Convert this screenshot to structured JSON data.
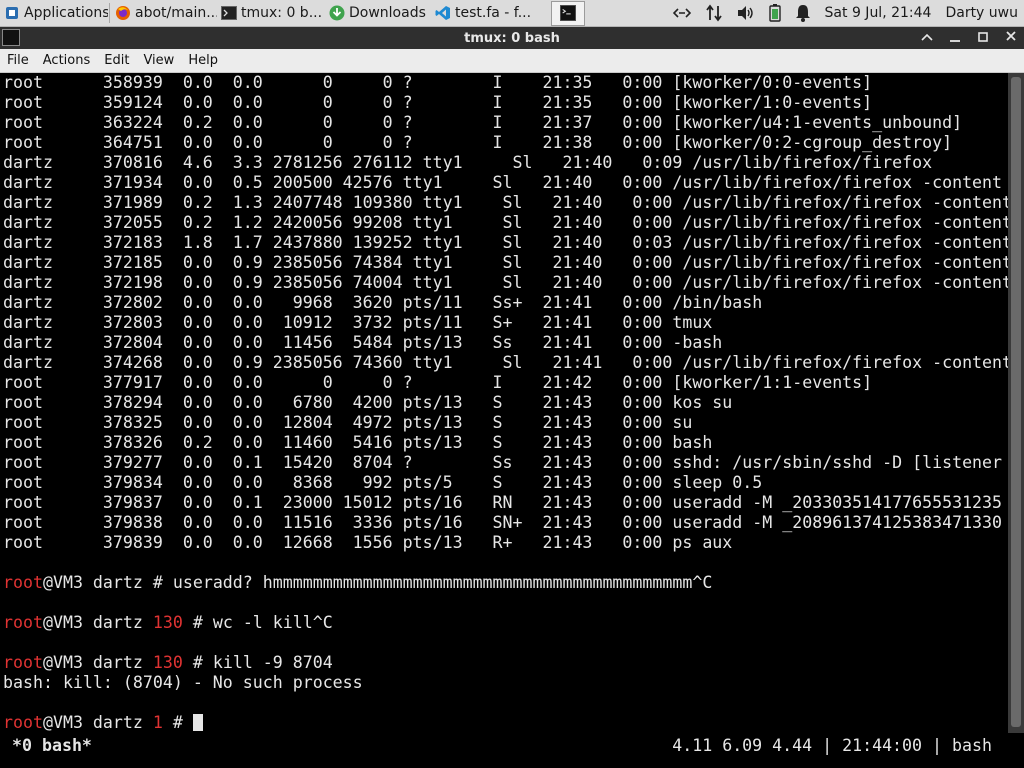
{
  "panel": {
    "tasks": [
      {
        "label": "Applications",
        "icon": "apps-icon"
      },
      {
        "label": "abot/main...",
        "icon": "firefox-icon"
      },
      {
        "label": "tmux: 0 b...",
        "icon": "terminal-icon"
      },
      {
        "label": "Downloads",
        "icon": "download-icon"
      },
      {
        "label": "test.fa - f...",
        "icon": "vscode-icon"
      },
      {
        "label": "",
        "icon": "terminal-icon"
      }
    ],
    "clock": "Sat  9 Jul, 21:44",
    "user": "Darty uwu"
  },
  "window": {
    "title": "tmux: 0 bash"
  },
  "menu": {
    "items": [
      "File",
      "Actions",
      "Edit",
      "View",
      "Help"
    ]
  },
  "terminal": {
    "ps_rows": [
      "root      358939  0.0  0.0      0     0 ?        I    21:35   0:00 [kworker/0:0-events]",
      "root      359124  0.0  0.0      0     0 ?        I    21:35   0:00 [kworker/1:0-events]",
      "root      363224  0.2  0.0      0     0 ?        I    21:37   0:00 [kworker/u4:1-events_unbound]",
      "root      364751  0.0  0.0      0     0 ?        I    21:38   0:00 [kworker/0:2-cgroup_destroy]",
      "dartz     370816  4.6  3.3 2781256 276112 tty1     Sl   21:40   0:09 /usr/lib/firefox/firefox",
      "dartz     371934  0.0  0.5 200500 42576 tty1     Sl   21:40   0:00 /usr/lib/firefox/firefox -content",
      "dartz     371989  0.2  1.3 2407748 109380 tty1    Sl   21:40   0:00 /usr/lib/firefox/firefox -content",
      "dartz     372055  0.2  1.2 2420056 99208 tty1     Sl   21:40   0:00 /usr/lib/firefox/firefox -content",
      "dartz     372183  1.8  1.7 2437880 139252 tty1    Sl   21:40   0:03 /usr/lib/firefox/firefox -content",
      "dartz     372185  0.0  0.9 2385056 74384 tty1     Sl   21:40   0:00 /usr/lib/firefox/firefox -content",
      "dartz     372198  0.0  0.9 2385056 74004 tty1     Sl   21:40   0:00 /usr/lib/firefox/firefox -content",
      "dartz     372802  0.0  0.0   9968  3620 pts/11   Ss+  21:41   0:00 /bin/bash",
      "dartz     372803  0.0  0.0  10912  3732 pts/11   S+   21:41   0:00 tmux",
      "dartz     372804  0.0  0.0  11456  5484 pts/13   Ss   21:41   0:00 -bash",
      "dartz     374268  0.0  0.9 2385056 74360 tty1     Sl   21:41   0:00 /usr/lib/firefox/firefox -content",
      "root      377917  0.0  0.0      0     0 ?        I    21:42   0:00 [kworker/1:1-events]",
      "root      378294  0.0  0.0   6780  4200 pts/13   S    21:43   0:00 kos su",
      "root      378325  0.0  0.0  12804  4972 pts/13   S    21:43   0:00 su",
      "root      378326  0.2  0.0  11460  5416 pts/13   S    21:43   0:00 bash",
      "root      379277  0.0  0.1  15420  8704 ?        Ss   21:43   0:00 sshd: /usr/sbin/sshd -D [listener",
      "root      379834  0.0  0.0   8368   992 pts/5    S    21:43   0:00 sleep 0.5",
      "root      379837  0.0  0.1  23000 15012 pts/16   RN   21:43   0:00 useradd -M _203303514177655531235",
      "root      379838  0.0  0.0  11516  3336 pts/16   SN+  21:43   0:00 useradd -M _208961374125383471330",
      "root      379839  0.0  0.0  12668  1556 pts/13   R+   21:43   0:00 ps aux"
    ],
    "prompts": [
      {
        "user": "root",
        "host": "@VM3 dartz ",
        "code": "",
        "hash": "# ",
        "cmd": "useradd? hmmmmmmmmmmmmmmmmmmmmmmmmmmmmmmmmmmmmmmmmmm^C"
      },
      {
        "user": "root",
        "host": "@VM3 dartz ",
        "code": "130",
        "hash": " # ",
        "cmd": "wc -l kill^C"
      },
      {
        "user": "root",
        "host": "@VM3 dartz ",
        "code": "130",
        "hash": " # ",
        "cmd": "kill -9 8704"
      },
      {
        "user": "root",
        "host": "@VM3 dartz ",
        "code": "1",
        "hash": " # ",
        "cmd": ""
      }
    ],
    "error_output": "bash: kill: (8704) - No such process"
  },
  "tmux": {
    "window_label": "*0 bash*",
    "load": "4.11 6.09 4.44",
    "time": "21:44:00",
    "session": "bash",
    "separator": " | "
  },
  "colors": {
    "prompt_red": "#e03333",
    "terminal_bg": "#000000",
    "terminal_fg": "#e6e6e6"
  }
}
